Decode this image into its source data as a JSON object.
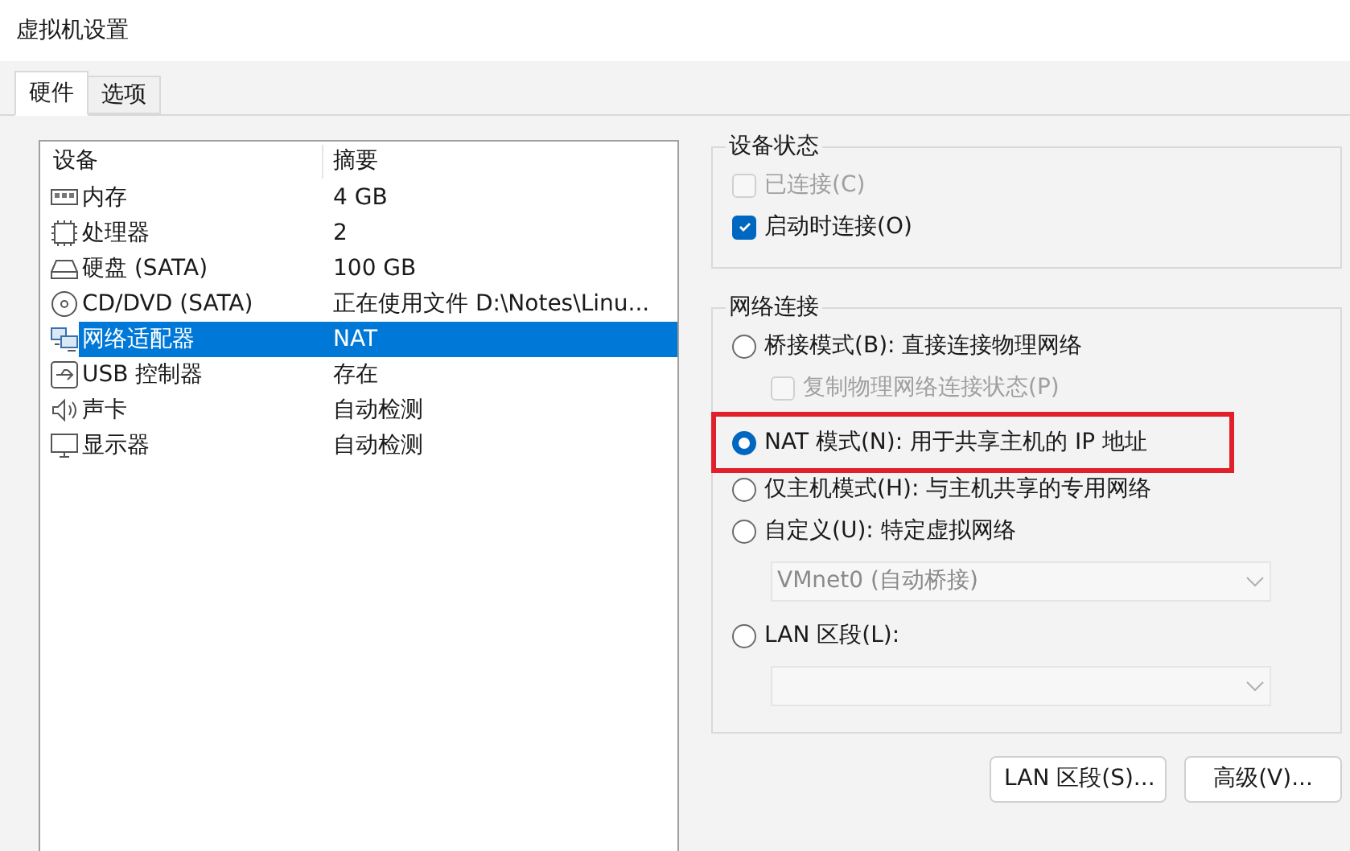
{
  "window": {
    "title": "虚拟机设置"
  },
  "tabs": [
    {
      "label": "硬件",
      "selected": true
    },
    {
      "label": "选项",
      "selected": false
    }
  ],
  "device_list": {
    "columns": [
      "设备",
      "摘要"
    ],
    "rows": [
      {
        "kind": "memory",
        "device": "内存",
        "summary": "4 GB",
        "selected": false
      },
      {
        "kind": "cpu",
        "device": "处理器",
        "summary": "2",
        "selected": false
      },
      {
        "kind": "disk",
        "device": "硬盘 (SATA)",
        "summary": "100 GB",
        "selected": false
      },
      {
        "kind": "cd",
        "device": "CD/DVD (SATA)",
        "summary": "正在使用文件 D:\\Notes\\Linu...",
        "selected": false
      },
      {
        "kind": "network",
        "device": "网络适配器",
        "summary": "NAT",
        "selected": true
      },
      {
        "kind": "usb",
        "device": "USB 控制器",
        "summary": "存在",
        "selected": false
      },
      {
        "kind": "sound",
        "device": "声卡",
        "summary": "自动检测",
        "selected": false
      },
      {
        "kind": "display",
        "device": "显示器",
        "summary": "自动检测",
        "selected": false
      }
    ]
  },
  "device_status": {
    "title": "设备状态",
    "items": [
      {
        "label": "已连接(C)",
        "checked": false,
        "disabled": true
      },
      {
        "label": "启动时连接(O)",
        "checked": true,
        "disabled": false
      }
    ]
  },
  "network_connection": {
    "title": "网络连接",
    "items": [
      {
        "kind": "radio",
        "label": "桥接模式(B): 直接连接物理网络",
        "selected": false,
        "highlighted": false
      },
      {
        "kind": "checkbox",
        "label": "复制物理网络连接状态(P)",
        "checked": false,
        "disabled": true
      },
      {
        "kind": "radio",
        "label": "NAT 模式(N): 用于共享主机的 IP 地址",
        "selected": true,
        "highlighted": true
      },
      {
        "kind": "radio",
        "label": "仅主机模式(H): 与主机共享的专用网络",
        "selected": false,
        "highlighted": false
      },
      {
        "kind": "radio",
        "label": "自定义(U): 特定虚拟网络",
        "selected": false,
        "highlighted": false
      },
      {
        "kind": "dropdown",
        "value": "VMnet0 (自动桥接)",
        "disabled": true
      },
      {
        "kind": "radio",
        "label": "LAN 区段(L):",
        "selected": false,
        "highlighted": false
      },
      {
        "kind": "dropdown",
        "disabled": true
      }
    ]
  },
  "buttons": [
    "LAN 区段(S)...",
    "高级(V)..."
  ]
}
